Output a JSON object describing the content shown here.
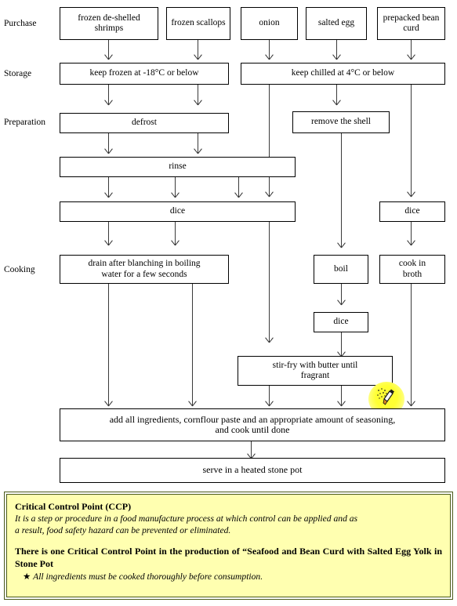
{
  "diagram": {
    "title": "HACCP process flow diagram",
    "stage_labels": [
      {
        "id": "purchase",
        "text": "Purchase"
      },
      {
        "id": "storage",
        "text": "Storage"
      },
      {
        "id": "preparation",
        "text": "Preparation"
      },
      {
        "id": "cooking",
        "text": "Cooking"
      }
    ],
    "nodes": {
      "frozen_shrimps": "frozen de-shelled shrimps",
      "frozen_scallops": "frozen scallops",
      "onion": "onion",
      "salted_egg": "salted egg",
      "bean_curd": "prepacked bean curd",
      "keep_frozen": "keep frozen at -18°C or below",
      "keep_chilled": "keep chilled at 4°C or below",
      "defrost": "defrost",
      "remove_shell": "remove the shell",
      "rinse": "rinse",
      "dice_left": "dice",
      "dice_right": "dice",
      "drain_blanch_l1": "drain after blanching in boiling",
      "drain_blanch_l2": "water for a few seconds",
      "boil": "boil",
      "cook_in_broth_l1": "cook in",
      "cook_in_broth_l2": "broth",
      "dice_egg": "dice",
      "stirfry_l1": "stir-fry with butter until",
      "stirfry_l2": "fragrant",
      "add_all_l1": "add all ingredients, cornflour paste and an appropriate amount of seasoning,",
      "add_all_l2": "and cook until done",
      "serve": "serve in a heated stone pot"
    },
    "ccp_marker": {
      "tag": "CCP",
      "icon_name": "thermometer-probe-icon",
      "glow_color": "#ffff33"
    }
  },
  "note": {
    "heading": "Critical Control Point (CCP)",
    "definition_l1": "It is a step or procedure in a food manufacture process at which control can be applied and as",
    "definition_l2": "a result, food safety hazard can be prevented or eliminated.",
    "statement": "There is one Critical Control Point in the production of “Seafood and Bean Curd with Salted Egg Yolk in Stone Pot",
    "bullet_symbol": "★",
    "bullet_text": "All ingredients must be cooked thoroughly before consumption.",
    "fill_color": "#ffffb0",
    "border_color": "#4a5a1a"
  }
}
